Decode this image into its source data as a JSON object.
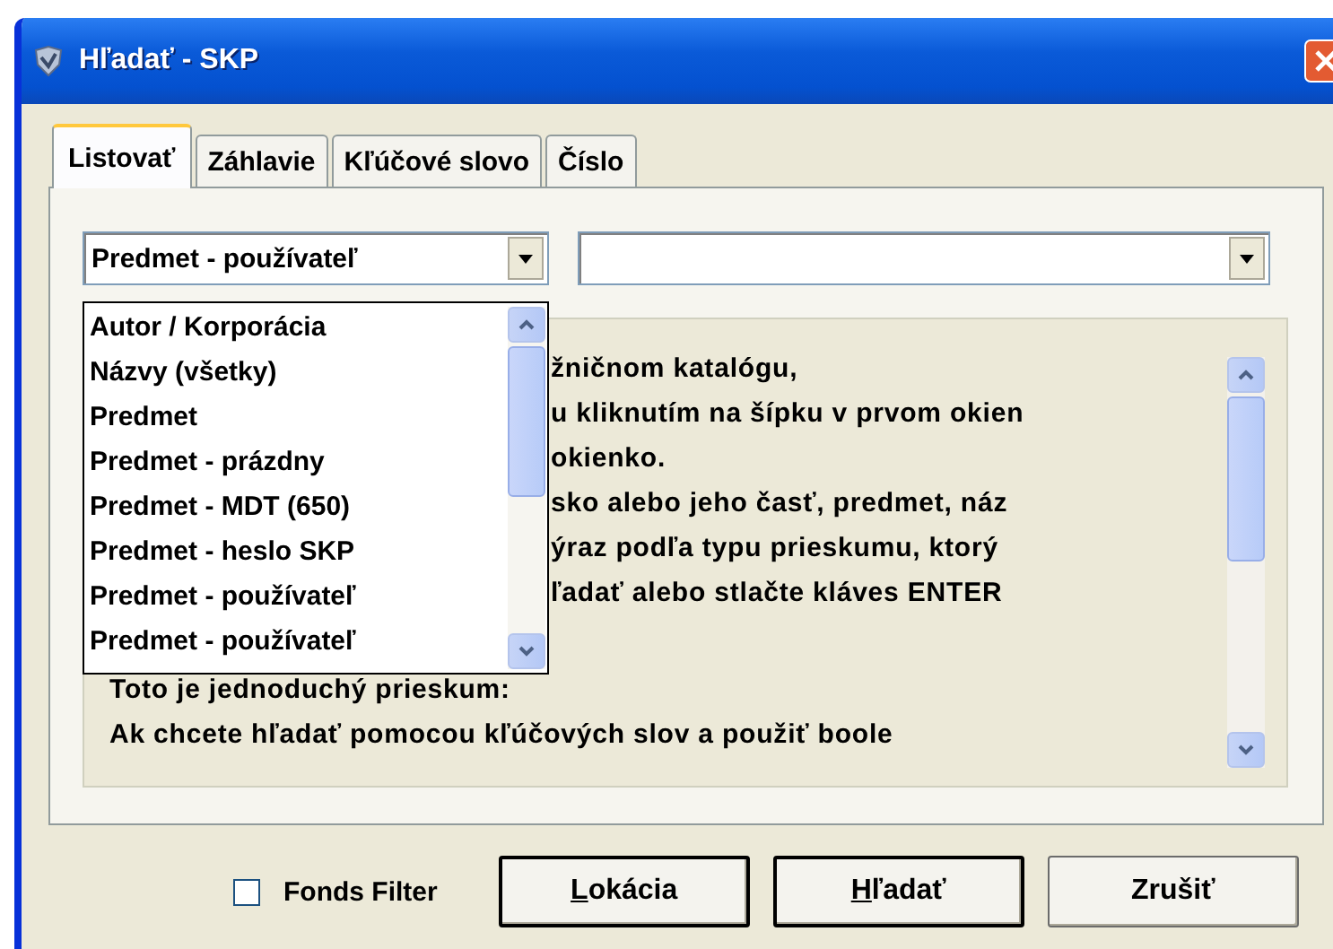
{
  "window": {
    "title": "Hľadať - SKP"
  },
  "tabs": [
    {
      "label": "Listovať",
      "selected": true
    },
    {
      "label": "Záhlavie",
      "selected": false
    },
    {
      "label": "Kľúčové slovo",
      "selected": false
    },
    {
      "label": "Číslo",
      "selected": false
    }
  ],
  "index_combo": {
    "value": "Predmet - používateľ",
    "expanded": true
  },
  "dropdown_items": [
    {
      "label": "Autor / Korporácia"
    },
    {
      "label": "Názvy (všetky)"
    },
    {
      "label": "Predmet"
    },
    {
      "label": "Predmet - prázdny"
    },
    {
      "label": "Predmet - MDT (650)"
    },
    {
      "label": "Predmet - heslo SKP"
    },
    {
      "label": "Predmet - používateľ"
    },
    {
      "label": "Predmet - používateľ"
    }
  ],
  "help_lines": [
    {
      "kind": "covered",
      "text": "žničnom katalógu,"
    },
    {
      "kind": "covered",
      "text": "u kliknutím na šípku v prvom okien"
    },
    {
      "kind": "covered",
      "text": "okienko."
    },
    {
      "kind": "covered",
      "text": "sko alebo jeho časť, predmet, náz"
    },
    {
      "kind": "covered",
      "text": "ýraz podľa typu prieskumu, ktorý"
    },
    {
      "kind": "covered",
      "text": "ľadať alebo stlačte kláves ENTER"
    },
    {
      "kind": "blank"
    },
    {
      "kind": "full",
      "text": "Toto je jednoduchý prieskum:"
    },
    {
      "kind": "full",
      "text": "Ak chcete hľadať pomocou kľúčových slov a použiť boole"
    }
  ],
  "fonds_filter": {
    "label": "Fonds Filter",
    "checked": false
  },
  "buttons": [
    {
      "label": "Lokácia",
      "access_key": true,
      "default": true
    },
    {
      "label": "Hľadať",
      "access_key": true,
      "default": true
    },
    {
      "label": "Zrušiť",
      "access_key": false,
      "default": false
    }
  ]
}
